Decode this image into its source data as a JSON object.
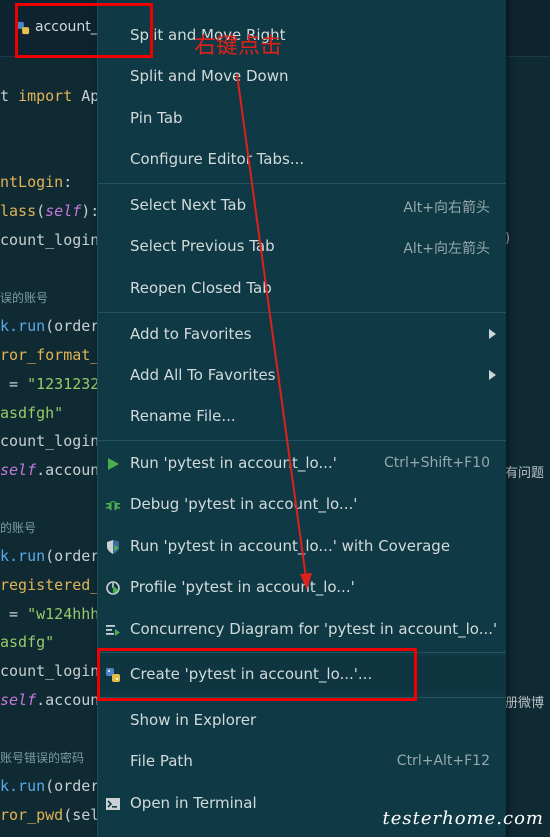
{
  "editor": {
    "tab_label": "account_",
    "code_lines": [
      {
        "parts": [
          [
            "t ",
            "plain"
          ],
          [
            "import ",
            "kw"
          ],
          [
            "Ap",
            "plain"
          ]
        ]
      },
      {
        "parts": [
          [
            "ntLogin",
            "kw"
          ],
          [
            ":",
            "plain"
          ]
        ]
      },
      {
        "parts": [
          [
            "lass",
            "kw"
          ],
          [
            "(",
            "plain"
          ],
          [
            "self",
            "self"
          ],
          [
            "):",
            "plain"
          ]
        ]
      },
      {
        "parts": [
          [
            "count_login",
            "plain"
          ]
        ]
      },
      {
        "parts": [
          [
            "误的账号",
            "cmt"
          ]
        ]
      },
      {
        "parts": [
          [
            "k.run",
            "fn"
          ],
          [
            "(order",
            "plain"
          ]
        ]
      },
      {
        "parts": [
          [
            "ror_format_",
            "kw"
          ]
        ]
      },
      {
        "parts": [
          [
            " = ",
            "plain"
          ],
          [
            "\"1231232",
            "str"
          ]
        ]
      },
      {
        "parts": [
          [
            "asdfgh\"",
            "str"
          ]
        ]
      },
      {
        "parts": [
          [
            "count_login",
            "plain"
          ]
        ]
      },
      {
        "parts": [
          [
            "self",
            "self"
          ],
          [
            ".accoun",
            "plain"
          ]
        ]
      },
      {
        "parts": [
          [
            "的账号",
            "cmt"
          ]
        ]
      },
      {
        "parts": [
          [
            "k.run",
            "fn"
          ],
          [
            "(order",
            "plain"
          ]
        ]
      },
      {
        "parts": [
          [
            "registered_",
            "kw"
          ]
        ]
      },
      {
        "parts": [
          [
            " = ",
            "plain"
          ],
          [
            "\"w124hhh",
            "str"
          ]
        ]
      },
      {
        "parts": [
          [
            "asdfg\"",
            "str"
          ]
        ]
      },
      {
        "parts": [
          [
            "count_login",
            "plain"
          ]
        ]
      },
      {
        "parts": [
          [
            "self",
            "self"
          ],
          [
            ".accoun",
            "plain"
          ]
        ]
      },
      {
        "parts": [
          [
            "账号错误的密码",
            "cmt"
          ]
        ]
      },
      {
        "parts": [
          [
            "k.run",
            "fn"
          ],
          [
            "(order",
            "plain"
          ]
        ]
      },
      {
        "parts": [
          [
            "ror_pwd",
            "kw"
          ],
          [
            "(sel",
            "plain"
          ]
        ]
      }
    ],
    "right_fragments": [
      ")",
      "有问题",
      "册微博"
    ]
  },
  "menu": {
    "items": [
      {
        "id": "split-and-move-right",
        "label": "Split and Move Right"
      },
      {
        "id": "split-and-move-down",
        "label": "Split and Move Down"
      },
      {
        "id": "pin-tab",
        "label": "Pin Tab"
      },
      {
        "id": "configure-editor-tabs",
        "label": "Configure Editor Tabs..."
      },
      {
        "id": "select-next-tab",
        "label": "Select Next Tab",
        "shortcut": "Alt+向右箭头"
      },
      {
        "id": "select-previous-tab",
        "label": "Select Previous Tab",
        "shortcut": "Alt+向左箭头"
      },
      {
        "id": "reopen-closed-tab",
        "label": "Reopen Closed Tab"
      },
      {
        "id": "add-to-favorites",
        "label": "Add to Favorites"
      },
      {
        "id": "add-all-to-favorites",
        "label": "Add All To Favorites"
      },
      {
        "id": "rename-file",
        "label": "Rename File..."
      },
      {
        "id": "run-pytest",
        "label": "Run 'pytest in account_lo...'",
        "shortcut": "Ctrl+Shift+F10",
        "icon": "run-icon"
      },
      {
        "id": "debug-pytest",
        "label": "Debug 'pytest in account_lo...'",
        "icon": "debug-icon"
      },
      {
        "id": "run-with-coverage",
        "label": "Run 'pytest in account_lo...' with Coverage",
        "icon": "coverage-icon"
      },
      {
        "id": "profile-pytest",
        "label": "Profile 'pytest in account_lo...'",
        "icon": "profile-icon"
      },
      {
        "id": "concurrency-diagram",
        "label": "Concurrency Diagram for 'pytest in account_lo...'",
        "icon": "concurrency-icon"
      },
      {
        "id": "create-pytest",
        "label": "Create 'pytest in account_lo...'...",
        "icon": "python-icon"
      },
      {
        "id": "show-in-explorer",
        "label": "Show in Explorer"
      },
      {
        "id": "file-path",
        "label": "File Path",
        "shortcut": "Ctrl+Alt+F12"
      },
      {
        "id": "open-in-terminal",
        "label": "Open in Terminal",
        "icon": "terminal-icon"
      }
    ]
  },
  "annotation": {
    "text": "右键点击",
    "color": "#e0201a"
  },
  "watermark": "testerhome.com",
  "colors": {
    "menu_bg": "#0f3944",
    "editor_bg": "#0f2a33",
    "run_green": "#4cae4f",
    "annotation_red": "#e00000"
  }
}
